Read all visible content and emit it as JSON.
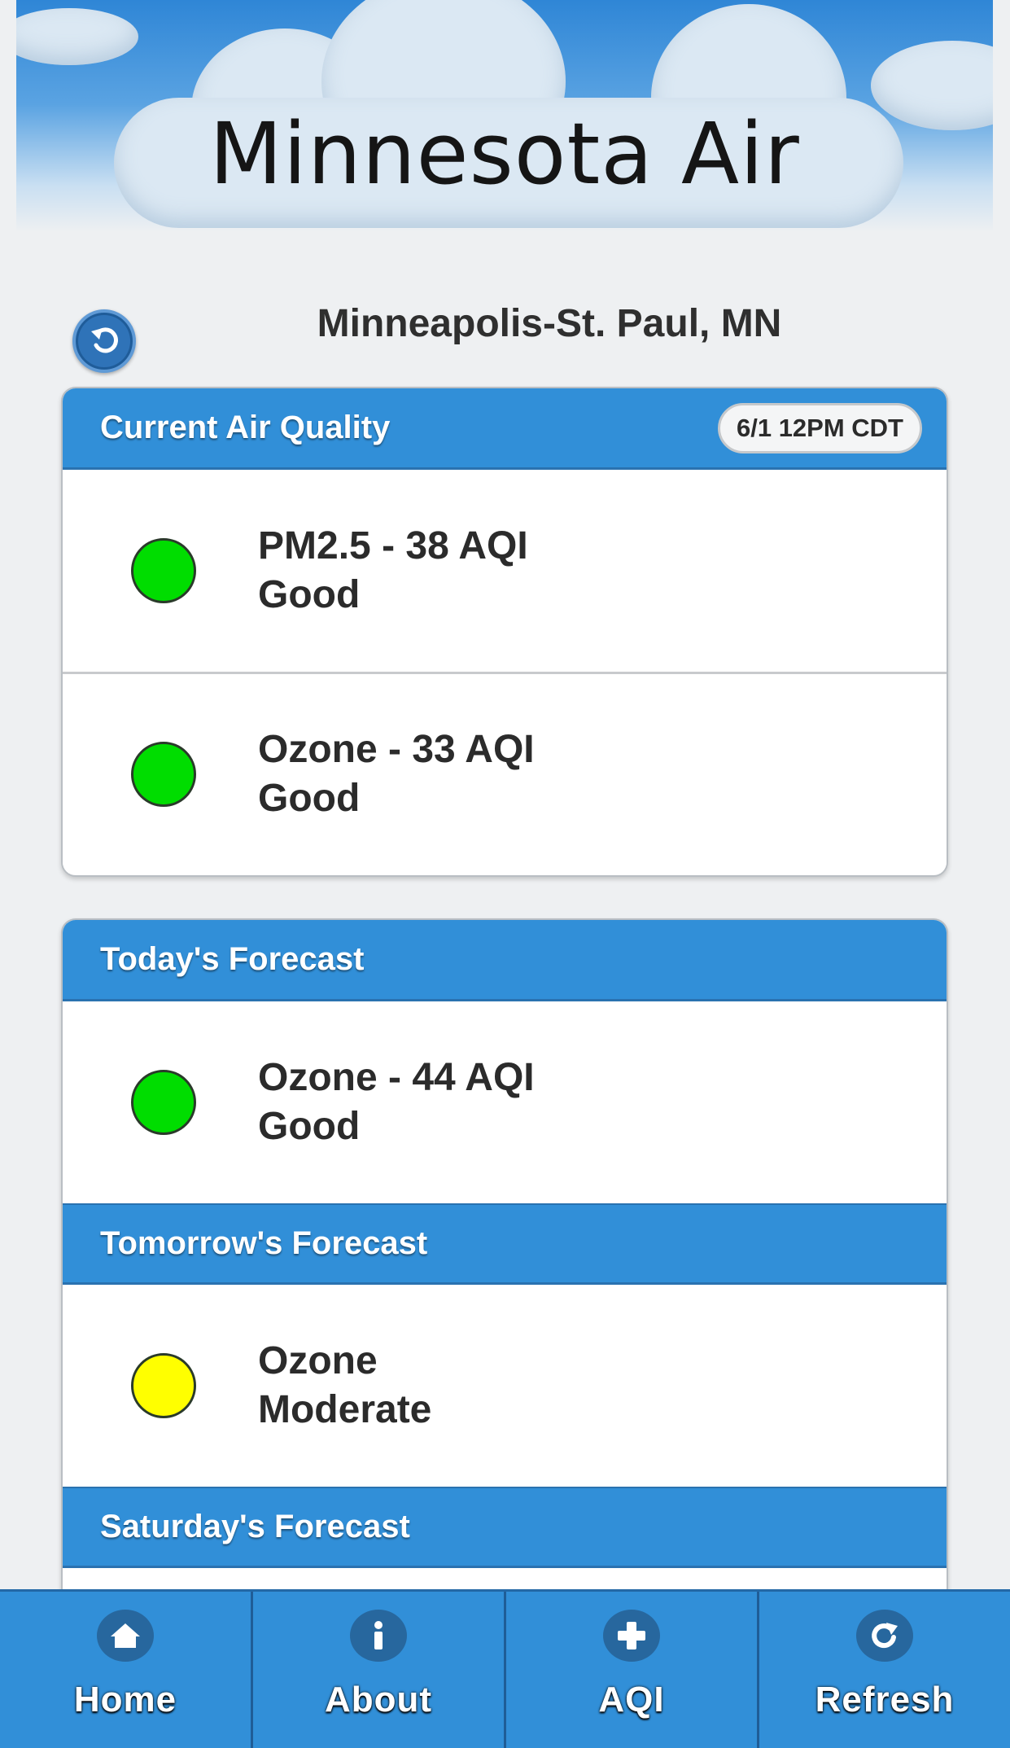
{
  "header": {
    "title": "Minnesota Air"
  },
  "location": {
    "name": "Minneapolis-St. Paul, MN"
  },
  "current": {
    "title": "Current Air Quality",
    "timestamp": "6/1 12PM CDT",
    "items": [
      {
        "line1": "PM2.5 - 38 AQI",
        "line2": "Good",
        "color": "#00dd00"
      },
      {
        "line1": "Ozone - 33 AQI",
        "line2": "Good",
        "color": "#00dd00"
      }
    ]
  },
  "forecast": {
    "today": {
      "title": "Today's Forecast",
      "line1": "Ozone - 44 AQI",
      "line2": "Good",
      "color": "#00dd00"
    },
    "tomorrow": {
      "title": "Tomorrow's Forecast",
      "line1": "Ozone",
      "line2": "Moderate",
      "color": "#ffff00"
    },
    "saturday": {
      "title": "Saturday's Forecast"
    }
  },
  "tabbar": {
    "items": [
      {
        "label": "Home",
        "icon": "home-icon"
      },
      {
        "label": "About",
        "icon": "info-icon"
      },
      {
        "label": "AQI",
        "icon": "plus-icon"
      },
      {
        "label": "Refresh",
        "icon": "refresh-icon"
      }
    ]
  }
}
